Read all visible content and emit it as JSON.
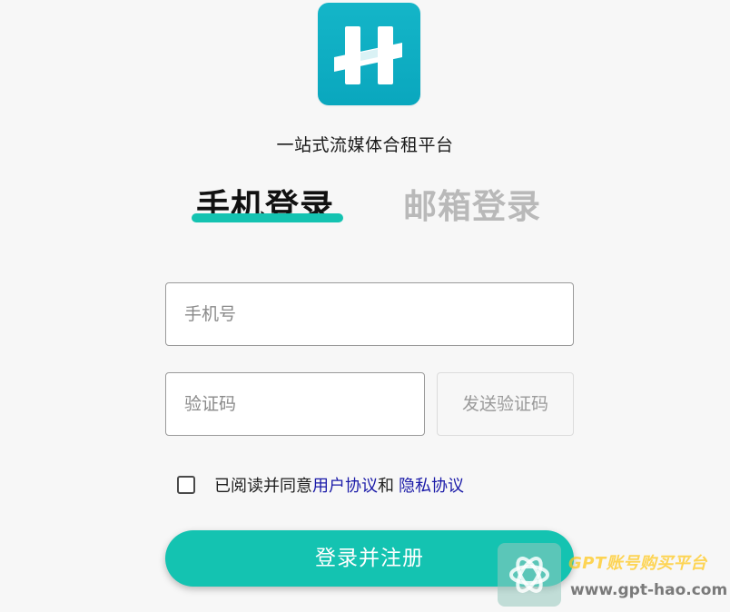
{
  "brand": {
    "tagline": "一站式流媒体合租平台",
    "logo_color": "#10aec4"
  },
  "tabs": [
    {
      "label": "手机登录",
      "active": true
    },
    {
      "label": "邮箱登录",
      "active": false
    }
  ],
  "form": {
    "phone_placeholder": "手机号",
    "code_placeholder": "验证码",
    "send_code_label": "发送验证码"
  },
  "agreement": {
    "prefix": "已阅读并同意",
    "user_agreement": "用户协议",
    "conjunction": "和",
    "privacy_policy": "隐私协议",
    "checked": false
  },
  "submit_label": "登录并注册",
  "watermark": {
    "title": "GPT账号购买平台",
    "url": "www.gpt-hao.com"
  },
  "colors": {
    "accent": "#14c3b1",
    "link": "#1a1aa8",
    "inactive_tab": "#b9b9b9"
  }
}
